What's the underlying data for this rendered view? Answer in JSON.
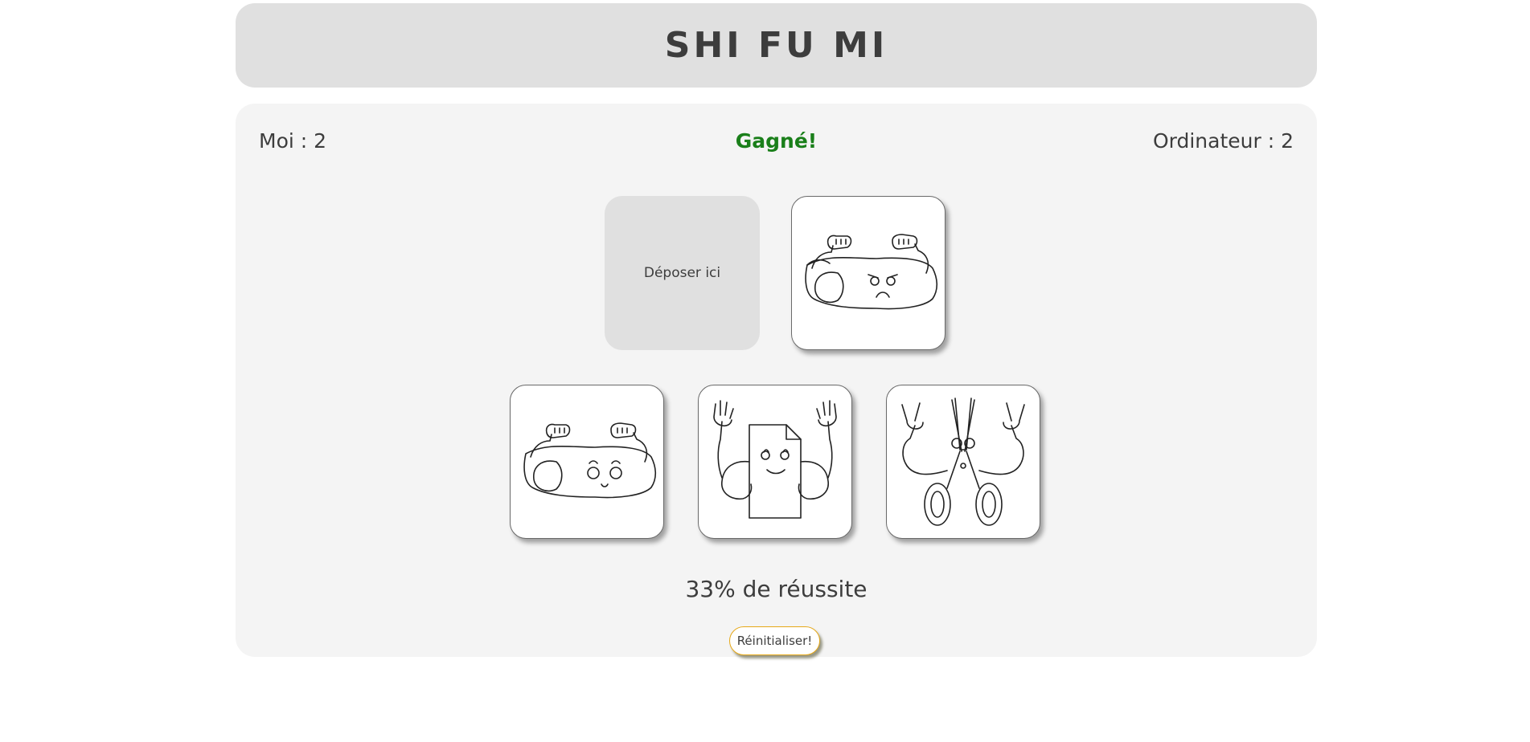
{
  "header": {
    "title": "SHI FU MI"
  },
  "score": {
    "player": "Moi : 2",
    "computer": "Ordinateur : 2",
    "result": "Gagné!"
  },
  "dropzone": {
    "label": "Déposer ici"
  },
  "computer_choice": {
    "icon": "rock-angry-icon"
  },
  "choices": [
    {
      "name": "rock",
      "icon": "rock-happy-icon"
    },
    {
      "name": "paper",
      "icon": "paper-icon"
    },
    {
      "name": "scissors",
      "icon": "scissors-icon"
    }
  ],
  "stats": {
    "success": "33% de réussite"
  },
  "reset": {
    "label": "Réinitialiser!"
  },
  "colors": {
    "result": "#1a7f1a",
    "reset_border": "#e6a817",
    "header_bg": "#e0e0e0",
    "board_bg": "#f4f4f4"
  }
}
